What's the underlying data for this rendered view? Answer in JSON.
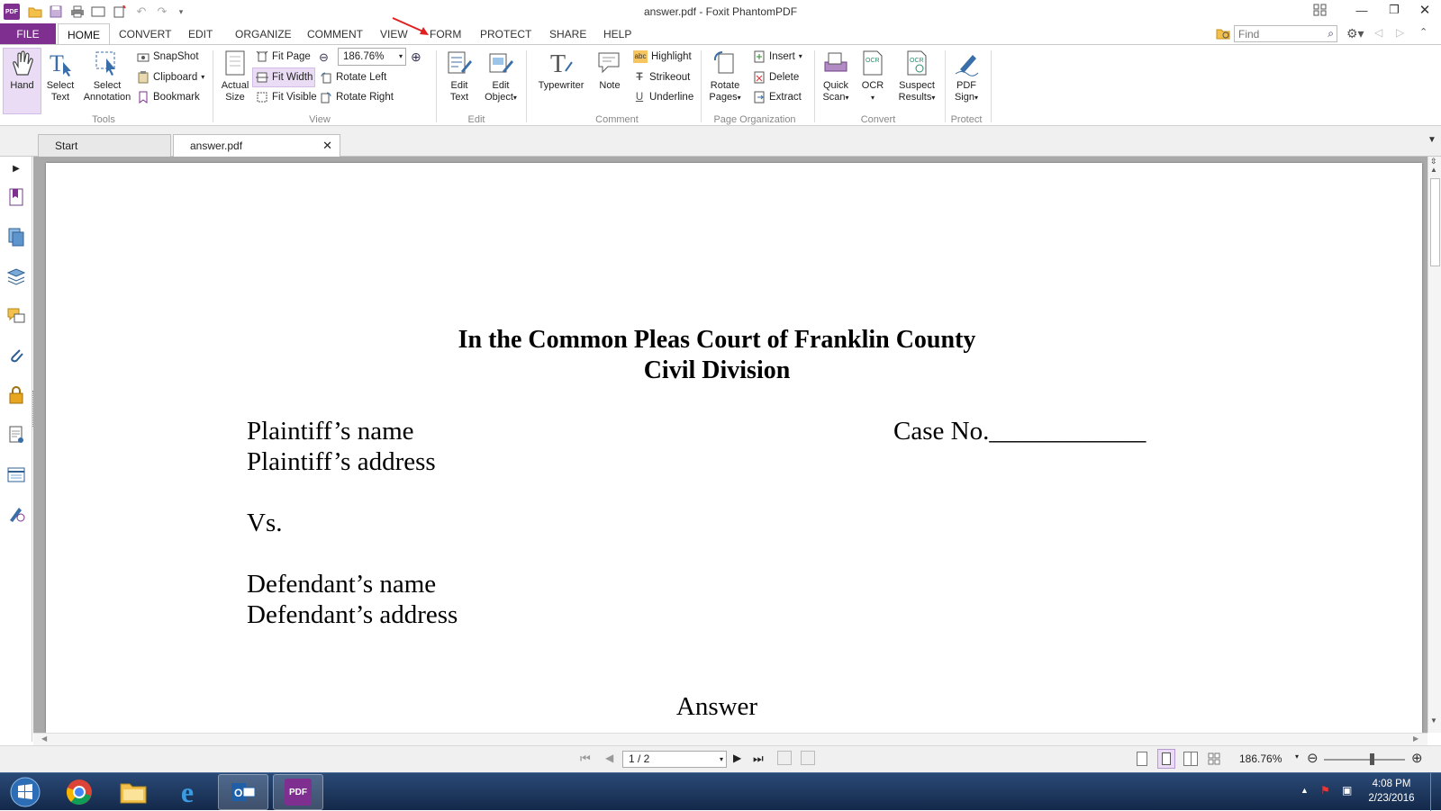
{
  "window": {
    "title": "answer.pdf - Foxit PhantomPDF"
  },
  "menu": {
    "file": "FILE",
    "tabs": [
      "HOME",
      "CONVERT",
      "EDIT",
      "ORGANIZE",
      "COMMENT",
      "VIEW",
      "FORM",
      "PROTECT",
      "SHARE",
      "HELP"
    ],
    "active_tab": "HOME",
    "search_placeholder": "Find"
  },
  "ribbon": {
    "tools": {
      "hand": "Hand",
      "select_text_1": "Select",
      "select_text_2": "Text",
      "select_annot_1": "Select",
      "select_annot_2": "Annotation",
      "snapshot": "SnapShot",
      "clipboard": "Clipboard",
      "bookmark": "Bookmark",
      "group": "Tools"
    },
    "view": {
      "actual_1": "Actual",
      "actual_2": "Size",
      "fit_page": "Fit Page",
      "fit_width": "Fit Width",
      "fit_visible": "Fit Visible",
      "zoom": "186.76%",
      "rotate_left": "Rotate Left",
      "rotate_right": "Rotate Right",
      "group": "View"
    },
    "edit": {
      "edit_text_1": "Edit",
      "edit_text_2": "Text",
      "edit_obj_1": "Edit",
      "edit_obj_2": "Object",
      "group": "Edit"
    },
    "comment": {
      "typewriter": "Typewriter",
      "note": "Note",
      "highlight": "Highlight",
      "strikeout": "Strikeout",
      "underline": "Underline",
      "group": "Comment"
    },
    "organize": {
      "rotate_1": "Rotate",
      "rotate_2": "Pages",
      "insert": "Insert",
      "delete": "Delete",
      "extract": "Extract",
      "group": "Page Organization"
    },
    "convert": {
      "quick_1": "Quick",
      "quick_2": "Scan",
      "ocr": "OCR",
      "suspect_1": "Suspect",
      "suspect_2": "Results",
      "group": "Convert"
    },
    "protect": {
      "sign_1": "PDF",
      "sign_2": "Sign",
      "group": "Protect"
    }
  },
  "doc_tabs": {
    "start": "Start",
    "active": "answer.pdf"
  },
  "document": {
    "heading1": "In the Common Pleas Court of Franklin County",
    "heading2": "Civil Division",
    "plaintiff_name": "Plaintiff’s name",
    "plaintiff_address": "Plaintiff’s address",
    "case_no": "Case No.____________",
    "vs": "Vs.",
    "defendant_name": "Defendant’s name",
    "defendant_address": "Defendant’s address",
    "answer": "Answer"
  },
  "status": {
    "page": "1 / 2",
    "zoom": "186.76%",
    "zoom_slider_fraction": 0.6
  },
  "taskbar": {
    "time": "4:08 PM",
    "date": "2/23/2016"
  },
  "colors": {
    "accent": "#7e2f8f",
    "arrow": "#e02020"
  }
}
